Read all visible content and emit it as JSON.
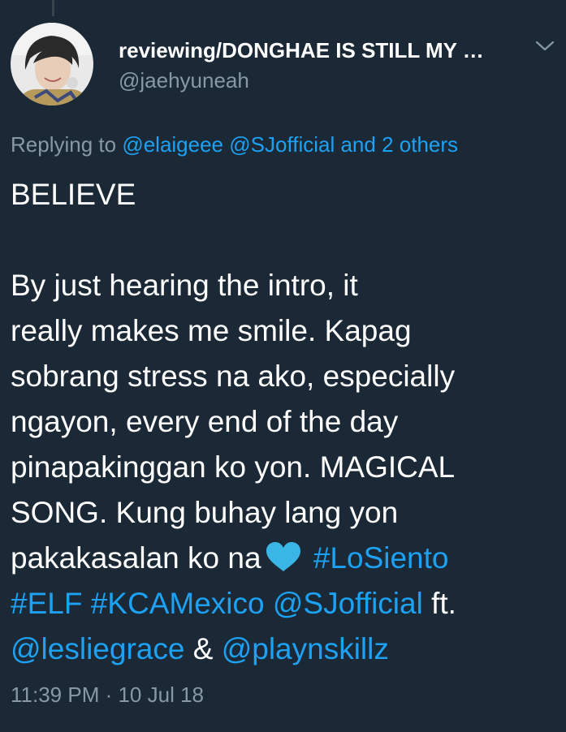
{
  "colors": {
    "background": "#1b2836",
    "text": "#ffffff",
    "muted": "#8899a6",
    "link": "#1da1f2",
    "heart": "#39b6e6"
  },
  "author": {
    "display_name": "reviewing/DONGHAE IS STILL MY …",
    "handle": "@jaehyuneah",
    "avatar_icon": "profile-photo"
  },
  "reply": {
    "prefix": "Replying to ",
    "mention1": "@elaigeee",
    "mention2": "@SJofficial",
    "others": "and 2 others"
  },
  "tweet": {
    "title": "BELIEVE",
    "lines": [
      "By just hearing the intro, it",
      "really makes me smile. Kapag",
      "sobrang stress na ako, especially",
      "ngayon, every end of the day",
      "pinapakinggan ko yon. MAGICAL",
      "SONG. Kung buhay lang yon"
    ],
    "line7_text": "pakakasalan ko na",
    "heart_icon": "blue-heart-emoji",
    "hashtag1": "#LoSiento",
    "hashtag2": "#ELF",
    "hashtag3": "#KCAMexico",
    "mention_sj": "@SJofficial",
    "ft": " ft.",
    "mention_leslie": "@lesliegrace",
    "amp": " & ",
    "mention_play": "@playnskillz"
  },
  "meta": {
    "timestamp": "11:39 PM · 10 Jul 18"
  },
  "icons": {
    "menu": "chevron-down-icon"
  }
}
